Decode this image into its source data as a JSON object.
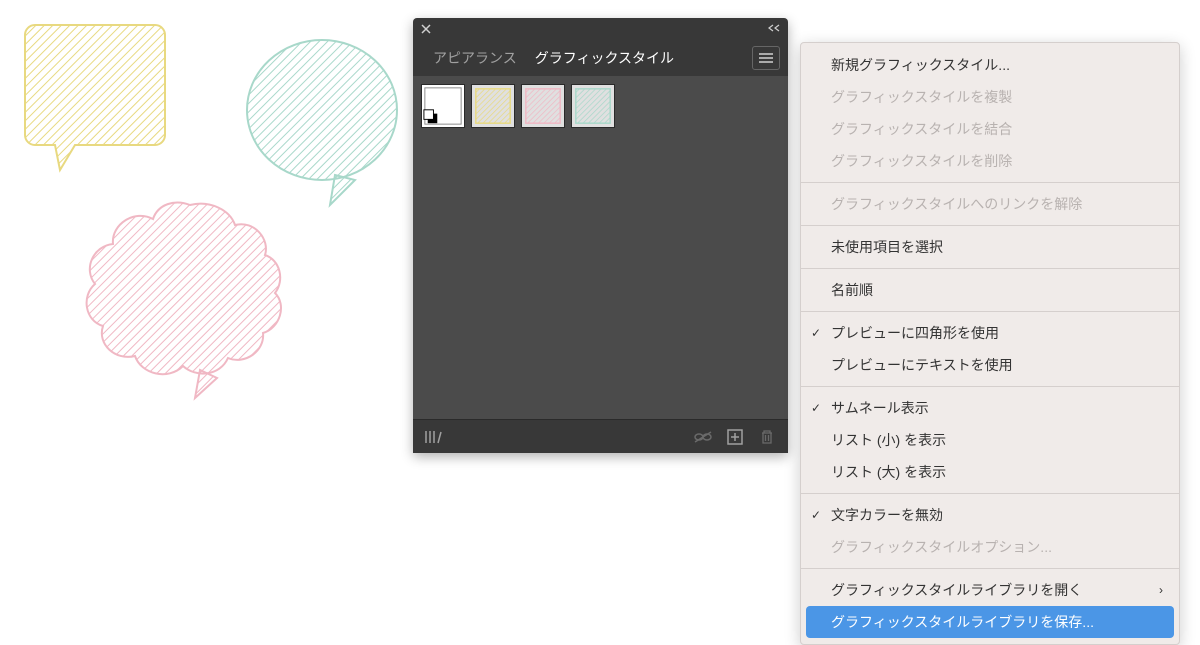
{
  "panel": {
    "tabs": [
      {
        "label": "アピアランス",
        "active": false
      },
      {
        "label": "グラフィックスタイル",
        "active": true
      }
    ],
    "swatches": [
      {
        "name": "default",
        "type": "default"
      },
      {
        "name": "yellow",
        "type": "hatch",
        "color": "#e8d980"
      },
      {
        "name": "pink",
        "type": "hatch",
        "color": "#f0b8c4"
      },
      {
        "name": "green",
        "type": "hatch",
        "color": "#a8d8ca"
      }
    ]
  },
  "flyout": {
    "groups": [
      [
        {
          "label": "新規グラフィックスタイル...",
          "enabled": true
        },
        {
          "label": "グラフィックスタイルを複製",
          "enabled": false
        },
        {
          "label": "グラフィックスタイルを結合",
          "enabled": false
        },
        {
          "label": "グラフィックスタイルを削除",
          "enabled": false
        }
      ],
      [
        {
          "label": "グラフィックスタイルへのリンクを解除",
          "enabled": false
        }
      ],
      [
        {
          "label": "未使用項目を選択",
          "enabled": true
        }
      ],
      [
        {
          "label": "名前順",
          "enabled": true
        }
      ],
      [
        {
          "label": "プレビューに四角形を使用",
          "enabled": true,
          "checked": true
        },
        {
          "label": "プレビューにテキストを使用",
          "enabled": true
        }
      ],
      [
        {
          "label": "サムネール表示",
          "enabled": true,
          "checked": true
        },
        {
          "label": "リスト (小) を表示",
          "enabled": true
        },
        {
          "label": "リスト (大) を表示",
          "enabled": true
        }
      ],
      [
        {
          "label": "文字カラーを無効",
          "enabled": true,
          "checked": true
        },
        {
          "label": "グラフィックスタイルオプション...",
          "enabled": false
        }
      ],
      [
        {
          "label": "グラフィックスタイルライブラリを開く",
          "enabled": true,
          "submenu": true
        },
        {
          "label": "グラフィックスタイルライブラリを保存...",
          "enabled": true,
          "highlight": true
        }
      ]
    ]
  },
  "icons": {
    "check": "✓",
    "arrow_right": "›"
  },
  "colors": {
    "yellow": "#e8d980",
    "green": "#a8d8ca",
    "pink": "#f0b8c4",
    "highlight": "#4b96e6"
  }
}
